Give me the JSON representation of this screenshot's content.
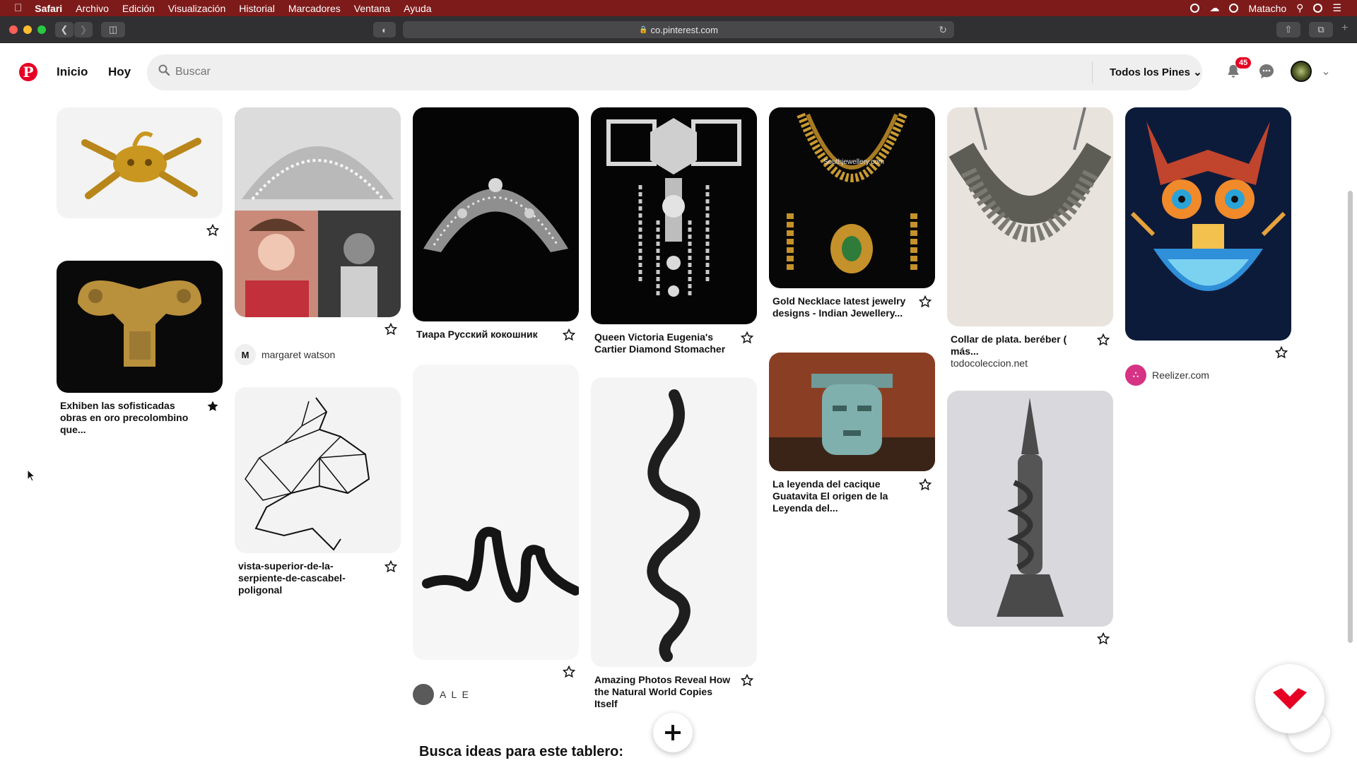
{
  "menubar": {
    "app": "Safari",
    "items": [
      "Archivo",
      "Edición",
      "Visualización",
      "Historial",
      "Marcadores",
      "Ventana",
      "Ayuda"
    ],
    "user": "Matacho"
  },
  "browser": {
    "url": "co.pinterest.com"
  },
  "header": {
    "home": "Inicio",
    "today": "Hoy",
    "search_placeholder": "Buscar",
    "filter": "Todos los Pines",
    "notifications_count": "45"
  },
  "pins": [
    {
      "title": "",
      "source": "",
      "user": ""
    },
    {
      "title": "Exhiben las sofisticadas obras en oro precolombino que...",
      "source": "",
      "user": ""
    },
    {
      "title": "",
      "source": "",
      "user": "margaret watson",
      "user_initial": "M"
    },
    {
      "title": "vista-superior-de-la-serpiente-de-cascabel-poligonal",
      "source": "",
      "user": ""
    },
    {
      "title": "Тиара Русский кокошник",
      "source": "",
      "user": ""
    },
    {
      "title": "",
      "source": "",
      "user": "A L E"
    },
    {
      "title": "Queen Victoria Eugenia's Cartier Diamond Stomacher",
      "source": "",
      "user": ""
    },
    {
      "title": "Amazing Photos Reveal How the Natural World Copies Itself",
      "source": "",
      "user": ""
    },
    {
      "title": "Gold Necklace latest jewelry designs - Indian Jewellery...",
      "source": "",
      "user": "",
      "watermark": "Southjewellery.com"
    },
    {
      "title": "La leyenda del cacique Guatavita El origen de la Leyenda del...",
      "source": "",
      "user": ""
    },
    {
      "title": "Collar de plata. beréber ( más...",
      "source": "todocoleccion.net",
      "user": ""
    },
    {
      "title": "",
      "source": "",
      "user": ""
    },
    {
      "title": "",
      "source": "",
      "user": "Reelizer.com"
    }
  ],
  "footer": {
    "ideas_title": "Busca ideas para este tablero:"
  },
  "colors": {
    "menubar": "#7d1b1b",
    "brand": "#e60023"
  }
}
